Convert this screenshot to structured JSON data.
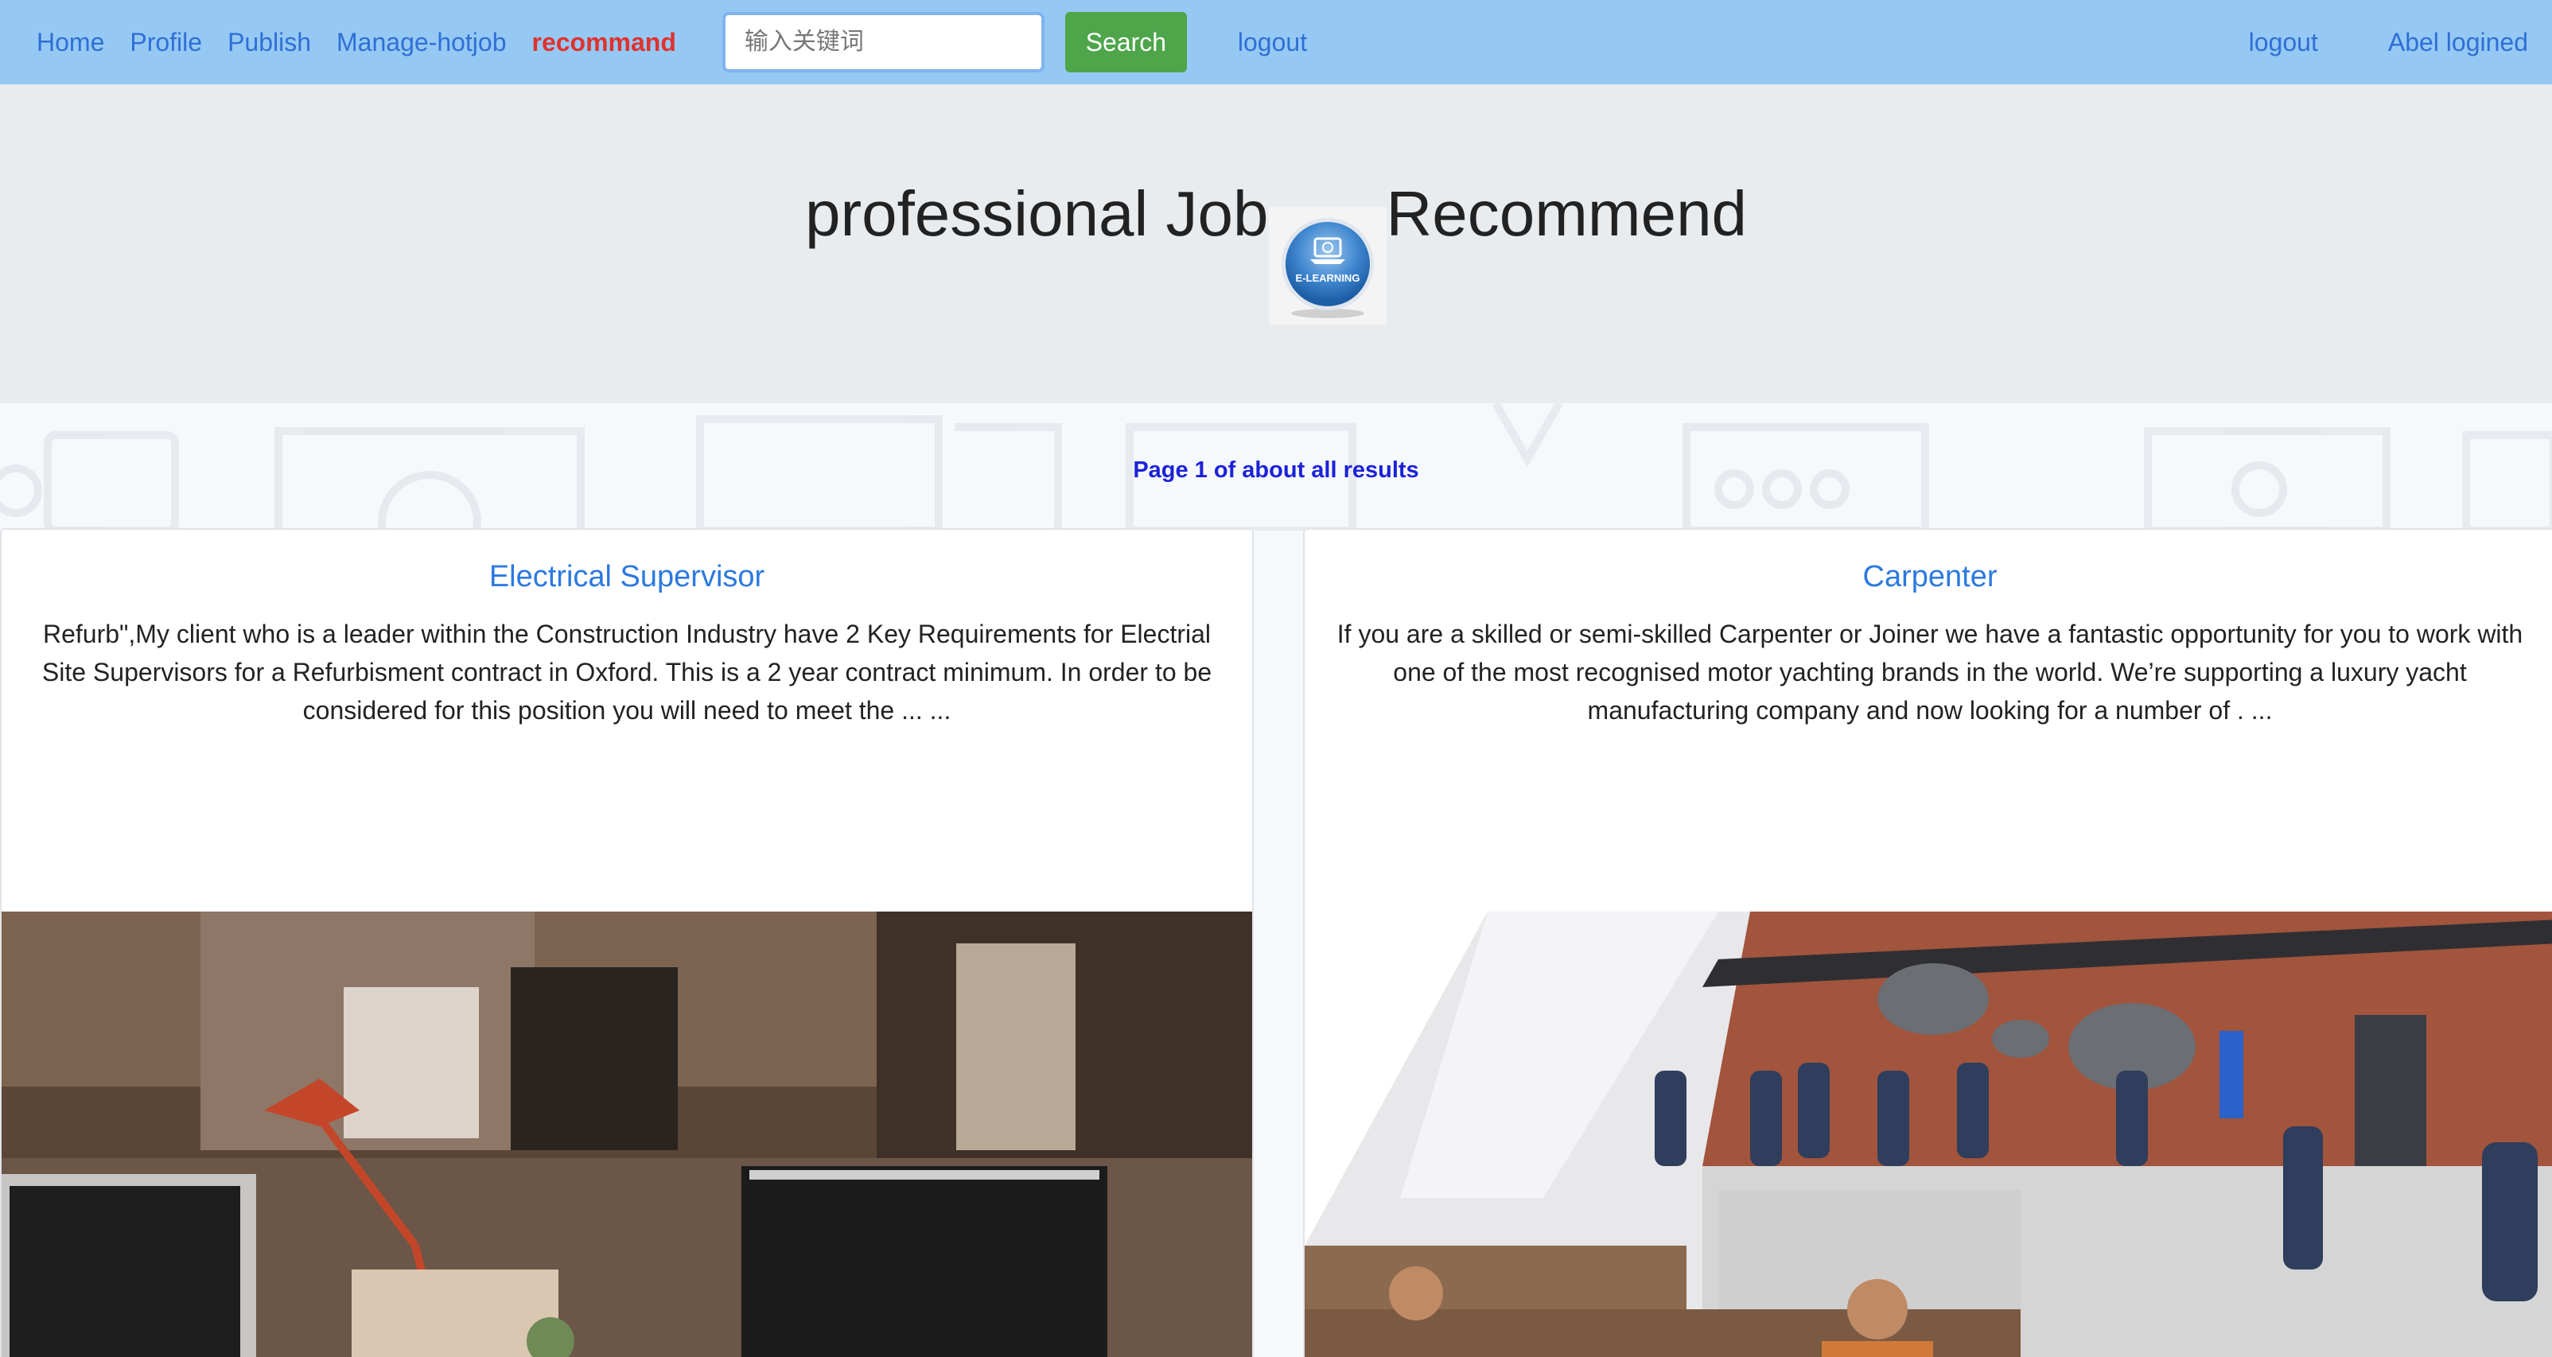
{
  "nav": {
    "links": [
      "Home",
      "Profile",
      "Publish",
      "Manage-hotjob",
      "recommand"
    ],
    "search_placeholder": "输入关键词",
    "search_label": "Search",
    "logout_mid": "logout",
    "logout_right": "logout",
    "user_status": "Abel logined",
    "colors": {
      "bar": "#95c9f3",
      "link": "#2f6fd6",
      "active": "#e0322e",
      "button": "#4ea54a"
    }
  },
  "hero": {
    "title_left": "professional Job",
    "title_right": "Recommend",
    "logo_text": "E-LEARNING",
    "logo_icon": "e-learning-logo-icon"
  },
  "results": {
    "page_info": "Page 1 of about all results",
    "cards": [
      {
        "title": "Electrical Supervisor",
        "text": "Refurb\",My client who is a leader within the Construction Industry have 2 Key Requirements for Electrial Site Supervisors for a Refurbisment contract in Oxford. This is a 2 year contract minimum. In order to be considered for this position you will need to meet the ... ..."
      },
      {
        "title": "Carpenter",
        "text": "If you are a skilled or semi-skilled Carpenter or Joiner we have a fantastic opportunity for you to work with one of the most recognised motor yachting brands in the world. We’re supporting a luxury yacht manufacturing company and now looking for a number of . ..."
      }
    ]
  }
}
